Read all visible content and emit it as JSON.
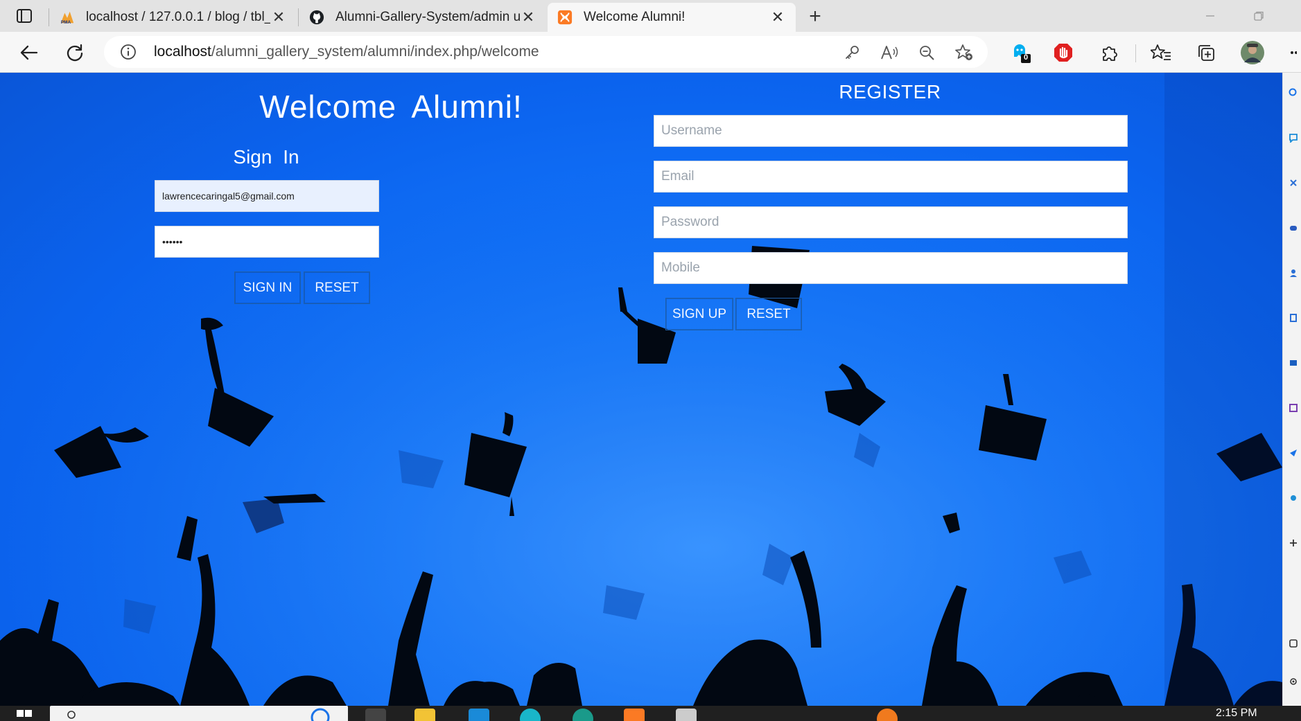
{
  "browser": {
    "tabs": [
      {
        "title": "localhost / 127.0.0.1 / blog / tbl_",
        "favicon": "phpmyadmin-icon",
        "active": false
      },
      {
        "title": "Alumni-Gallery-System/admin us",
        "favicon": "github-icon",
        "active": false
      },
      {
        "title": "Welcome Alumni!",
        "favicon": "xampp-icon",
        "active": true
      }
    ],
    "close_glyph": "✕",
    "new_tab_glyph": "+",
    "address": {
      "host": "localhost",
      "path": "/alumni_gallery_system/alumni/index.php/welcome"
    },
    "extension_badge": "0"
  },
  "page": {
    "welcome_title": "Welcome Alumni!",
    "signin": {
      "title": "Sign In",
      "email_value": "lawrencecaringal5@gmail.com",
      "password_value": "••••••",
      "signin_label": "SIGN IN",
      "reset_label": "RESET"
    },
    "register": {
      "title": "REGISTER",
      "username_placeholder": "Username",
      "email_placeholder": "Email",
      "password_placeholder": "Password",
      "mobile_placeholder": "Mobile",
      "signup_label": "SIGN UP",
      "reset_label": "RESET"
    }
  },
  "taskbar": {
    "clock": "2:15 PM"
  },
  "colors": {
    "page_background": "#0b6cf5",
    "silhouette": "#020812",
    "autofill": "#e8f0fe",
    "accent": "#1f5fa8"
  }
}
